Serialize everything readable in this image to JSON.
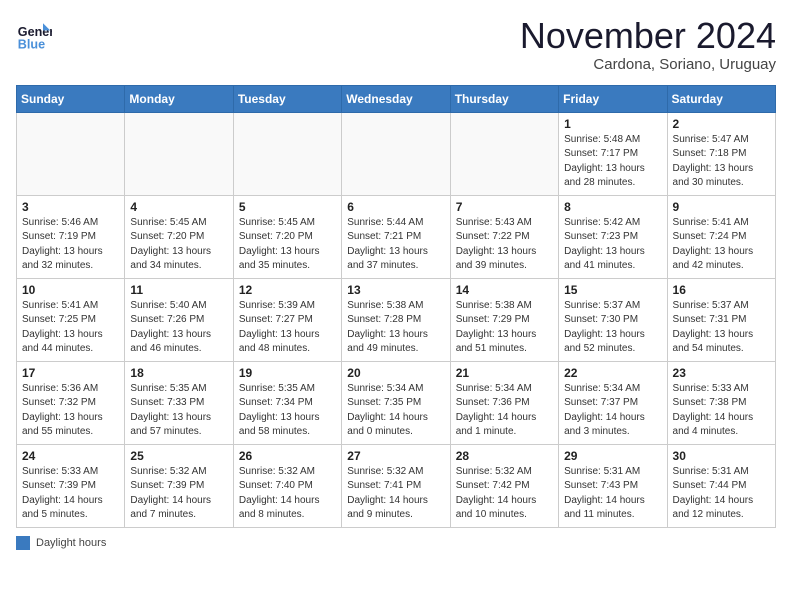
{
  "logo": {
    "line1": "General",
    "line2": "Blue"
  },
  "title": "November 2024",
  "location": "Cardona, Soriano, Uruguay",
  "weekdays": [
    "Sunday",
    "Monday",
    "Tuesday",
    "Wednesday",
    "Thursday",
    "Friday",
    "Saturday"
  ],
  "legend_label": "Daylight hours",
  "weeks": [
    [
      {
        "day": "",
        "info": ""
      },
      {
        "day": "",
        "info": ""
      },
      {
        "day": "",
        "info": ""
      },
      {
        "day": "",
        "info": ""
      },
      {
        "day": "",
        "info": ""
      },
      {
        "day": "1",
        "info": "Sunrise: 5:48 AM\nSunset: 7:17 PM\nDaylight: 13 hours\nand 28 minutes."
      },
      {
        "day": "2",
        "info": "Sunrise: 5:47 AM\nSunset: 7:18 PM\nDaylight: 13 hours\nand 30 minutes."
      }
    ],
    [
      {
        "day": "3",
        "info": "Sunrise: 5:46 AM\nSunset: 7:19 PM\nDaylight: 13 hours\nand 32 minutes."
      },
      {
        "day": "4",
        "info": "Sunrise: 5:45 AM\nSunset: 7:20 PM\nDaylight: 13 hours\nand 34 minutes."
      },
      {
        "day": "5",
        "info": "Sunrise: 5:45 AM\nSunset: 7:20 PM\nDaylight: 13 hours\nand 35 minutes."
      },
      {
        "day": "6",
        "info": "Sunrise: 5:44 AM\nSunset: 7:21 PM\nDaylight: 13 hours\nand 37 minutes."
      },
      {
        "day": "7",
        "info": "Sunrise: 5:43 AM\nSunset: 7:22 PM\nDaylight: 13 hours\nand 39 minutes."
      },
      {
        "day": "8",
        "info": "Sunrise: 5:42 AM\nSunset: 7:23 PM\nDaylight: 13 hours\nand 41 minutes."
      },
      {
        "day": "9",
        "info": "Sunrise: 5:41 AM\nSunset: 7:24 PM\nDaylight: 13 hours\nand 42 minutes."
      }
    ],
    [
      {
        "day": "10",
        "info": "Sunrise: 5:41 AM\nSunset: 7:25 PM\nDaylight: 13 hours\nand 44 minutes."
      },
      {
        "day": "11",
        "info": "Sunrise: 5:40 AM\nSunset: 7:26 PM\nDaylight: 13 hours\nand 46 minutes."
      },
      {
        "day": "12",
        "info": "Sunrise: 5:39 AM\nSunset: 7:27 PM\nDaylight: 13 hours\nand 48 minutes."
      },
      {
        "day": "13",
        "info": "Sunrise: 5:38 AM\nSunset: 7:28 PM\nDaylight: 13 hours\nand 49 minutes."
      },
      {
        "day": "14",
        "info": "Sunrise: 5:38 AM\nSunset: 7:29 PM\nDaylight: 13 hours\nand 51 minutes."
      },
      {
        "day": "15",
        "info": "Sunrise: 5:37 AM\nSunset: 7:30 PM\nDaylight: 13 hours\nand 52 minutes."
      },
      {
        "day": "16",
        "info": "Sunrise: 5:37 AM\nSunset: 7:31 PM\nDaylight: 13 hours\nand 54 minutes."
      }
    ],
    [
      {
        "day": "17",
        "info": "Sunrise: 5:36 AM\nSunset: 7:32 PM\nDaylight: 13 hours\nand 55 minutes."
      },
      {
        "day": "18",
        "info": "Sunrise: 5:35 AM\nSunset: 7:33 PM\nDaylight: 13 hours\nand 57 minutes."
      },
      {
        "day": "19",
        "info": "Sunrise: 5:35 AM\nSunset: 7:34 PM\nDaylight: 13 hours\nand 58 minutes."
      },
      {
        "day": "20",
        "info": "Sunrise: 5:34 AM\nSunset: 7:35 PM\nDaylight: 14 hours\nand 0 minutes."
      },
      {
        "day": "21",
        "info": "Sunrise: 5:34 AM\nSunset: 7:36 PM\nDaylight: 14 hours\nand 1 minute."
      },
      {
        "day": "22",
        "info": "Sunrise: 5:34 AM\nSunset: 7:37 PM\nDaylight: 14 hours\nand 3 minutes."
      },
      {
        "day": "23",
        "info": "Sunrise: 5:33 AM\nSunset: 7:38 PM\nDaylight: 14 hours\nand 4 minutes."
      }
    ],
    [
      {
        "day": "24",
        "info": "Sunrise: 5:33 AM\nSunset: 7:39 PM\nDaylight: 14 hours\nand 5 minutes."
      },
      {
        "day": "25",
        "info": "Sunrise: 5:32 AM\nSunset: 7:39 PM\nDaylight: 14 hours\nand 7 minutes."
      },
      {
        "day": "26",
        "info": "Sunrise: 5:32 AM\nSunset: 7:40 PM\nDaylight: 14 hours\nand 8 minutes."
      },
      {
        "day": "27",
        "info": "Sunrise: 5:32 AM\nSunset: 7:41 PM\nDaylight: 14 hours\nand 9 minutes."
      },
      {
        "day": "28",
        "info": "Sunrise: 5:32 AM\nSunset: 7:42 PM\nDaylight: 14 hours\nand 10 minutes."
      },
      {
        "day": "29",
        "info": "Sunrise: 5:31 AM\nSunset: 7:43 PM\nDaylight: 14 hours\nand 11 minutes."
      },
      {
        "day": "30",
        "info": "Sunrise: 5:31 AM\nSunset: 7:44 PM\nDaylight: 14 hours\nand 12 minutes."
      }
    ]
  ]
}
